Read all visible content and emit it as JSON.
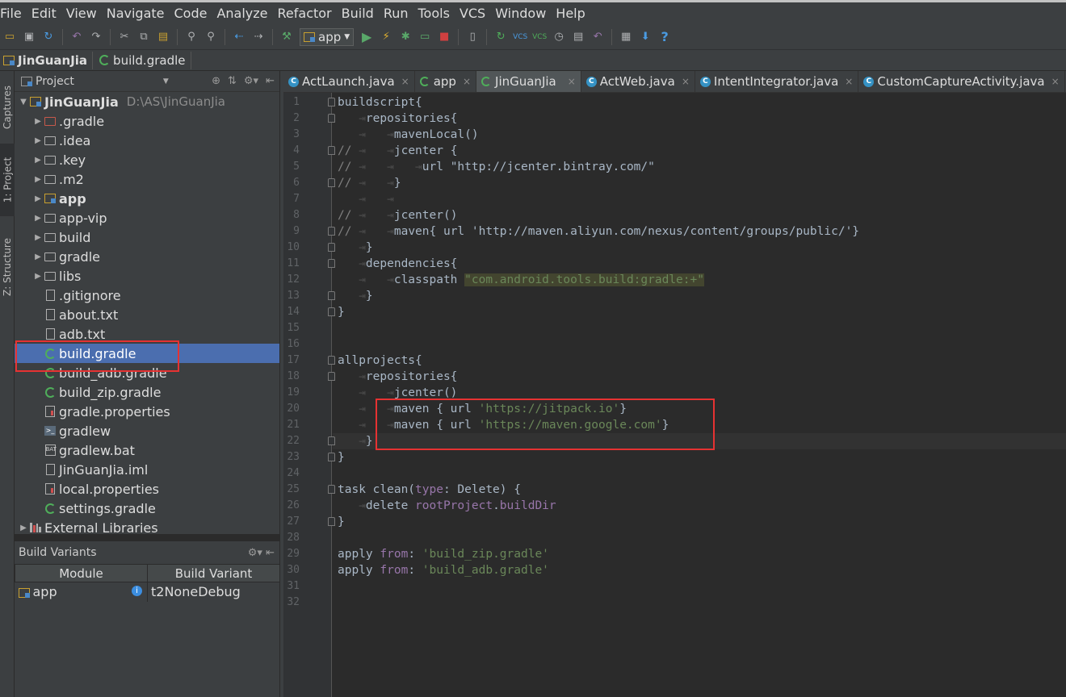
{
  "menu": [
    "File",
    "Edit",
    "View",
    "Navigate",
    "Code",
    "Analyze",
    "Refactor",
    "Build",
    "Run",
    "Tools",
    "VCS",
    "Window",
    "Help"
  ],
  "toolbar": {
    "run_config": "app",
    "help": "?"
  },
  "breadcrumb": [
    "JinGuanJia",
    "build.gradle"
  ],
  "left_strip": [
    "Captures",
    "1: Project",
    "Z: Structure"
  ],
  "project": {
    "header": "Project",
    "root": {
      "name": "JinGuanJia",
      "path": "D:\\AS\\JinGuanJia"
    },
    "items": [
      {
        "label": ".gradle"
      },
      {
        "label": ".idea"
      },
      {
        "label": ".key"
      },
      {
        "label": ".m2"
      },
      {
        "label": "app"
      },
      {
        "label": "app-vip"
      },
      {
        "label": "build"
      },
      {
        "label": "gradle"
      },
      {
        "label": "libs"
      },
      {
        "label": ".gitignore"
      },
      {
        "label": "about.txt"
      },
      {
        "label": "adb.txt"
      },
      {
        "label": "build.gradle"
      },
      {
        "label": "build_adb.gradle"
      },
      {
        "label": "build_zip.gradle"
      },
      {
        "label": "gradle.properties"
      },
      {
        "label": "gradlew"
      },
      {
        "label": "gradlew.bat"
      },
      {
        "label": "JinGuanJia.iml"
      },
      {
        "label": "local.properties"
      },
      {
        "label": "settings.gradle"
      },
      {
        "label": "External Libraries"
      }
    ]
  },
  "build_variants": {
    "title": "Build Variants",
    "columns": [
      "Module",
      "Build Variant"
    ],
    "rows": [
      {
        "module": "app",
        "variant": "t2NoneDebug"
      }
    ]
  },
  "tabs": [
    {
      "label": "ActLaunch.java",
      "close": "×"
    },
    {
      "label": "app",
      "close": "×"
    },
    {
      "label": "JinGuanJia",
      "close": "×"
    },
    {
      "label": "ActWeb.java",
      "close": "×"
    },
    {
      "label": "IntentIntegrator.java",
      "close": "×"
    },
    {
      "label": "CustomCaptureActivity.java",
      "close": "×"
    }
  ],
  "editor": {
    "line_numbers": [
      "1",
      "2",
      "3",
      "4",
      "5",
      "6",
      "7",
      "8",
      "9",
      "10",
      "11",
      "12",
      "13",
      "14",
      "15",
      "16",
      "17",
      "18",
      "19",
      "20",
      "21",
      "22",
      "23",
      "24",
      "25",
      "26",
      "27",
      "28",
      "29",
      "30",
      "31",
      "32"
    ],
    "lines": {
      "l1": "buildscript{",
      "l2": "repositories{",
      "l3": "mavenLocal()",
      "l4a": "//",
      "l4b": "jcenter {",
      "l5a": "//",
      "l5b": "url \"http://jcenter.bintray.com/\"",
      "l6a": "//",
      "l6b": "}",
      "l8a": "//",
      "l8b": "jcenter()",
      "l9a": "//",
      "l9b": "maven{ url 'http://maven.aliyun.com/nexus/content/groups/public/'}",
      "l10": "}",
      "l11": "dependencies{",
      "l12a": "classpath ",
      "l12b": "\"com.android.tools.build:gradle:+\"",
      "l13": "}",
      "l14": "}",
      "l17": "allprojects{",
      "l18": "repositories{",
      "l19": "jcenter()",
      "l20a": "maven { url ",
      "l20b": "'https://jitpack.io'",
      "l20c": "}",
      "l21a": "maven { url ",
      "l21b": "'https://maven.google.com'",
      "l21c": "}",
      "l22": "}",
      "l23": "}",
      "l25a": "task clean(",
      "l25b": "type",
      "l25c": ": Delete) {",
      "l26a": "delete ",
      "l26b": "rootProject",
      "l26c": ".",
      "l26d": "buildDir",
      "l27": "}",
      "l29a": "apply ",
      "l29b": "from",
      "l29c": ": ",
      "l29d": "'build_zip.gradle'",
      "l30a": "apply ",
      "l30b": "from",
      "l30c": ": ",
      "l30d": "'build_adb.gradle'"
    }
  },
  "colors": {
    "selection": "#4b6eaf",
    "highlight_box": "#e63232",
    "string": "#6a8759",
    "keyword": "#cc7832"
  }
}
